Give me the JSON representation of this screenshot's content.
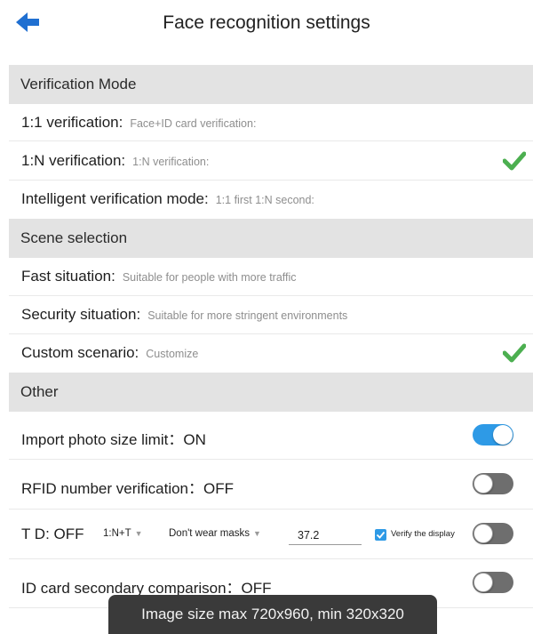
{
  "header": {
    "title": "Face recognition settings",
    "back_icon": "arrow-left-icon"
  },
  "colors": {
    "accent": "#2e9ae6",
    "check": "#4caf50",
    "section_bg": "#e3e3e3",
    "toggle_off": "#6e6e6e",
    "toast_bg": "#3a3a3a"
  },
  "verification_mode": {
    "title": "Verification Mode",
    "items": [
      {
        "label": "1:1 verification:",
        "sub": "Face+ID card verification:",
        "selected": false
      },
      {
        "label": "1:N verification:",
        "sub": "1:N verification:",
        "selected": true
      },
      {
        "label": "Intelligent verification mode:",
        "sub": "1:1 first 1:N second:",
        "selected": false
      }
    ]
  },
  "scene_selection": {
    "title": "Scene selection",
    "items": [
      {
        "label": "Fast situation:",
        "sub": "Suitable for people with more traffic",
        "selected": false
      },
      {
        "label": "Security situation:",
        "sub": "Suitable for more stringent environments",
        "selected": false
      },
      {
        "label": "Custom scenario:",
        "sub": "Customize",
        "selected": true
      }
    ]
  },
  "other": {
    "title": "Other",
    "import_photo": {
      "label": "Import photo size limit：",
      "state": "ON",
      "on": true
    },
    "rfid": {
      "label": "RFID number verification：",
      "state": "OFF",
      "on": false
    },
    "td": {
      "label": "T D: OFF",
      "mode_select": "1:N+T",
      "mask_select": "Don't wear masks",
      "temperature": "37.2",
      "verify_display_label": "Verify the display",
      "verify_display_checked": true,
      "on": false
    },
    "id_card": {
      "label": "ID card secondary comparison：",
      "state": "OFF",
      "on": false
    }
  },
  "toast": {
    "text": "Image size max 720x960, min 320x320"
  }
}
